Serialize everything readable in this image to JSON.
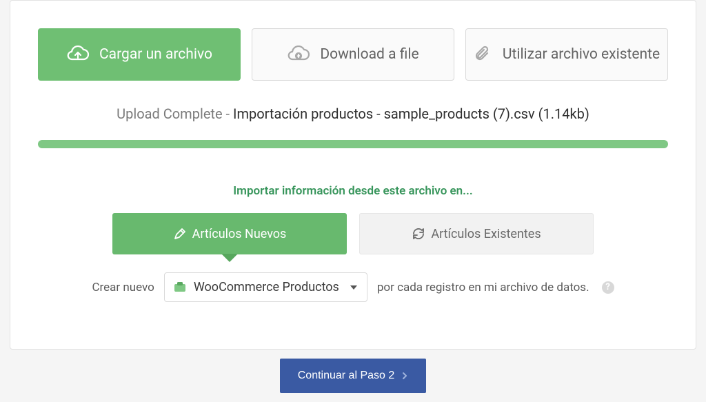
{
  "tabs": {
    "upload": "Cargar un archivo",
    "download": "Download a file",
    "existing": "Utilizar archivo existente"
  },
  "status": {
    "prefix": "Upload Complete",
    "sep": " - ",
    "name": "Importación productos - sample_products (7).csv",
    "size": "(1.14kb)"
  },
  "import_title": "Importar información desde este archivo en...",
  "subtabs": {
    "new": "Artículos Nuevos",
    "existing": "Artículos Existentes"
  },
  "create": {
    "prefix": "Crear nuevo",
    "option": "WooCommerce Productos",
    "suffix": "por cada registro en mi archivo de datos."
  },
  "footer": {
    "continue": "Continuar al Paso 2"
  }
}
